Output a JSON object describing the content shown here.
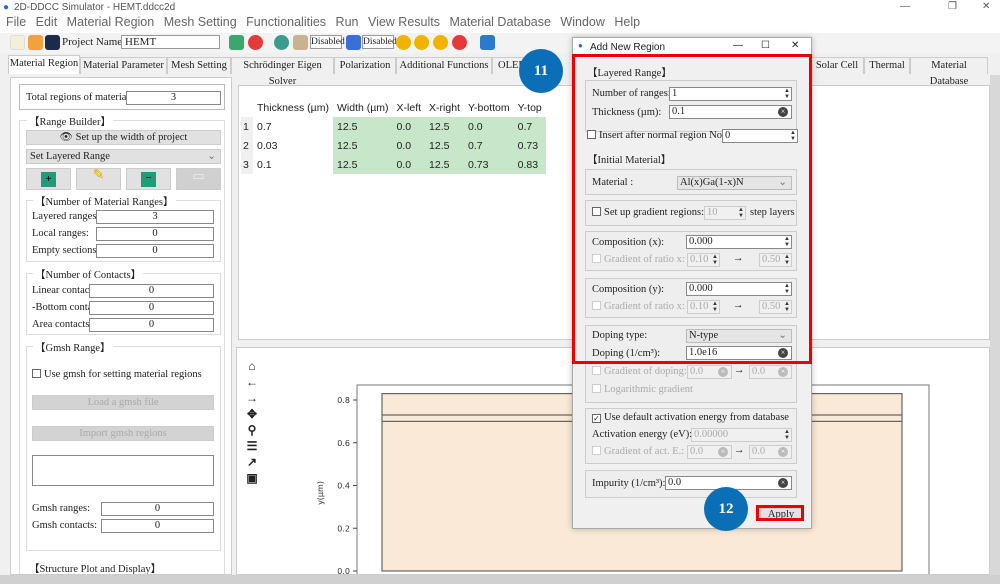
{
  "window": {
    "title": "2D-DDCC Simulator - HEMT.ddcc2d",
    "minimize": "—",
    "restore": "❐",
    "close": "✕"
  },
  "menu": [
    "File",
    "Edit",
    "Material Region",
    "Mesh Setting",
    "Functionalities",
    "Run",
    "View Results",
    "Material Database",
    "Window",
    "Help"
  ],
  "toolbar": {
    "project_label": "Project Name:",
    "project_name": "HEMT",
    "disabled1": "Disabled",
    "disabled2": "Disabled"
  },
  "tabs": [
    "Material Region",
    "Material Parameter",
    "Mesh Setting",
    "Schrödinger Eigen Solver",
    "Polarization",
    "Additional Functions",
    "OLED",
    "Solar Cell",
    "Thermal",
    "Material Database"
  ],
  "left": {
    "total_label": "Total regions of materials:",
    "total_value": "3",
    "range_builder": "【Range Builder】",
    "setup_width": "Set up the width of project",
    "range_select": "Set Layered Range",
    "num_ranges_title": "【Number of Material Ranges】",
    "layered_label": "Layered ranges:",
    "layered_value": "3",
    "local_label": "Local ranges:",
    "local_value": "0",
    "empty_label": "Empty sections:",
    "empty_value": "0",
    "contacts_title": "【Number of Contacts】",
    "linear_label": "Linear contact",
    "linear_value": "0",
    "bottom_label": "-Bottom conta",
    "bottom_value": "0",
    "area_label": "Area contacts:",
    "area_value": "0",
    "gmsh_title": "【Gmsh Range】",
    "use_gmsh": "Use gmsh for setting material regions",
    "load_gmsh": "Load a gmsh file",
    "import_gmsh": "Import gmsh regions",
    "gmsh_ranges_label": "Gmsh ranges:",
    "gmsh_ranges_value": "0",
    "gmsh_contacts_label": "Gmsh contacts:",
    "gmsh_contacts_value": "0",
    "structure_title": "【Structure Plot and Display】"
  },
  "table": {
    "headers": [
      "Thickness (µm)",
      "Width (µm)",
      "X-left",
      "X-right",
      "Y-bottom",
      "Y-top"
    ],
    "rows": [
      [
        "1",
        "0.7",
        "12.5",
        "0.0",
        "12.5",
        "0.0",
        "0.7"
      ],
      [
        "2",
        "0.03",
        "12.5",
        "0.0",
        "12.5",
        "0.7",
        "0.73"
      ],
      [
        "3",
        "0.1",
        "12.5",
        "0.0",
        "12.5",
        "0.73",
        "0.83"
      ]
    ]
  },
  "plot_tools": [
    "home-icon",
    "back-arrow-icon",
    "forward-arrow-icon",
    "pan-icon",
    "zoom-icon",
    "configure-icon",
    "edit-axis-icon",
    "save-icon"
  ],
  "chart_data": {
    "type": "area",
    "ylabel": "y(µm)",
    "yticks": [
      "0.0",
      "0.2",
      "0.4",
      "0.6",
      "0.8"
    ],
    "ylim": [
      0,
      0.86
    ],
    "layers": [
      {
        "y_bottom": 0.0,
        "y_top": 0.7
      },
      {
        "y_bottom": 0.7,
        "y_top": 0.73
      },
      {
        "y_bottom": 0.73,
        "y_top": 0.83
      }
    ],
    "fill": "#fae9d6"
  },
  "dialog": {
    "title": "Add New Region",
    "layered_range": "【Layered Range】",
    "num_ranges_label": "Number of ranges:",
    "num_ranges_value": "1",
    "thickness_label": "Thickness (µm):",
    "thickness_value": "0.1",
    "insert_after_label": "Insert after normal region No.:",
    "insert_after_value": "0",
    "initial_material": "【Initial Material】",
    "material_label": "Material :",
    "material_value": "Al(x)Ga(1-x)N",
    "gradient_regions_label": "Set up gradient regions:",
    "gradient_regions_value": "10",
    "step_layers": "step layers",
    "comp_x_label": "Composition (x):",
    "comp_x_value": "0.000",
    "grad_x_label": "Gradient of ratio x:",
    "grad_x_from": "0.10",
    "grad_x_to": "0.50",
    "comp_y_label": "Composition (y):",
    "comp_y_value": "0.000",
    "grad_y_label": "Gradient of ratio x:",
    "grad_y_from": "0.10",
    "grad_y_to": "0.50",
    "doping_type_label": "Doping type:",
    "doping_type_value": "N-type",
    "doping_label": "Doping (1/cm³):",
    "doping_value": "1.0e16",
    "grad_doping_label": "Gradient of doping:",
    "grad_doping_from": "0.0",
    "grad_doping_to": "0.0",
    "log_gradient": "Logarithmic gradient",
    "use_default_act": "Use default activation energy from database",
    "act_label": "Activation energy (eV):",
    "act_value": "0.00000",
    "grad_act_label": "Gradient of act. E.:",
    "grad_act_from": "0.0",
    "grad_act_to": "0.0",
    "impurity_label": "Impurity (1/cm³):",
    "impurity_value": "0.0",
    "apply": "Apply"
  },
  "annotations": {
    "step11": "11",
    "step12": "12"
  },
  "colors": {
    "highlight": "#ee0000",
    "annotation": "#0b6fb8",
    "table_green": "#c8e6c9",
    "layer_fill": "#fae9d6"
  }
}
